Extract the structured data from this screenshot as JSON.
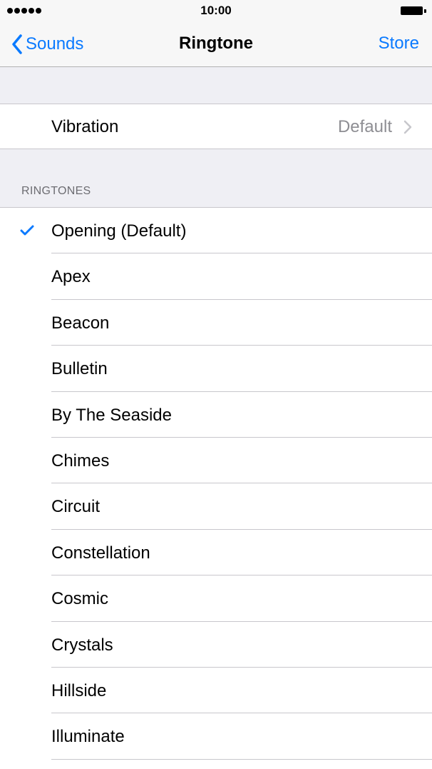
{
  "status_bar": {
    "time": "10:00",
    "signal_bars": 5
  },
  "nav": {
    "back_label": "Sounds",
    "title": "Ringtone",
    "store_label": "Store"
  },
  "vibration": {
    "label": "Vibration",
    "value": "Default"
  },
  "ringtones": {
    "header": "RINGTONES",
    "selected_index": 0,
    "items": [
      {
        "label": "Opening (Default)",
        "selected": true
      },
      {
        "label": "Apex",
        "selected": false
      },
      {
        "label": "Beacon",
        "selected": false
      },
      {
        "label": "Bulletin",
        "selected": false
      },
      {
        "label": "By The Seaside",
        "selected": false
      },
      {
        "label": "Chimes",
        "selected": false
      },
      {
        "label": "Circuit",
        "selected": false
      },
      {
        "label": "Constellation",
        "selected": false
      },
      {
        "label": "Cosmic",
        "selected": false
      },
      {
        "label": "Crystals",
        "selected": false
      },
      {
        "label": "Hillside",
        "selected": false
      },
      {
        "label": "Illuminate",
        "selected": false
      }
    ]
  },
  "colors": {
    "accent": "#0a7aff",
    "secondary_text": "#8e8e93",
    "group_background": "#efeff4",
    "separator": "#c8c7cc"
  },
  "icons": {
    "back": "chevron-left-icon",
    "disclosure": "chevron-right-icon",
    "selected": "checkmark-icon",
    "battery": "battery-icon",
    "signal": "signal-dots-icon"
  }
}
